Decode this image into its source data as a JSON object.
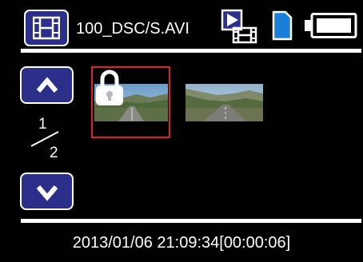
{
  "header": {
    "mode_icon": "film-strip-icon",
    "filename": "100_DSC/S.AVI",
    "status_icons": [
      "video-playback-icon",
      "sd-card-icon",
      "battery-full-icon"
    ]
  },
  "pager": {
    "up_icon": "chevron-up-icon",
    "down_icon": "chevron-down-icon",
    "current_page": "1",
    "total_pages": "2"
  },
  "thumbnails": [
    {
      "name": "road-clip-1",
      "locked": true,
      "selected": true,
      "lock_icon": "lock-icon"
    },
    {
      "name": "road-clip-2",
      "locked": false,
      "selected": false
    }
  ],
  "footer": {
    "timestamp": "2013/01/06 21:09:34[00:00:06]"
  },
  "colors": {
    "background": "#000000",
    "button_fill": "#2c2f8a",
    "selection_border": "#e0202a",
    "sd_card": "#1a7fd6",
    "text": "#ffffff"
  }
}
